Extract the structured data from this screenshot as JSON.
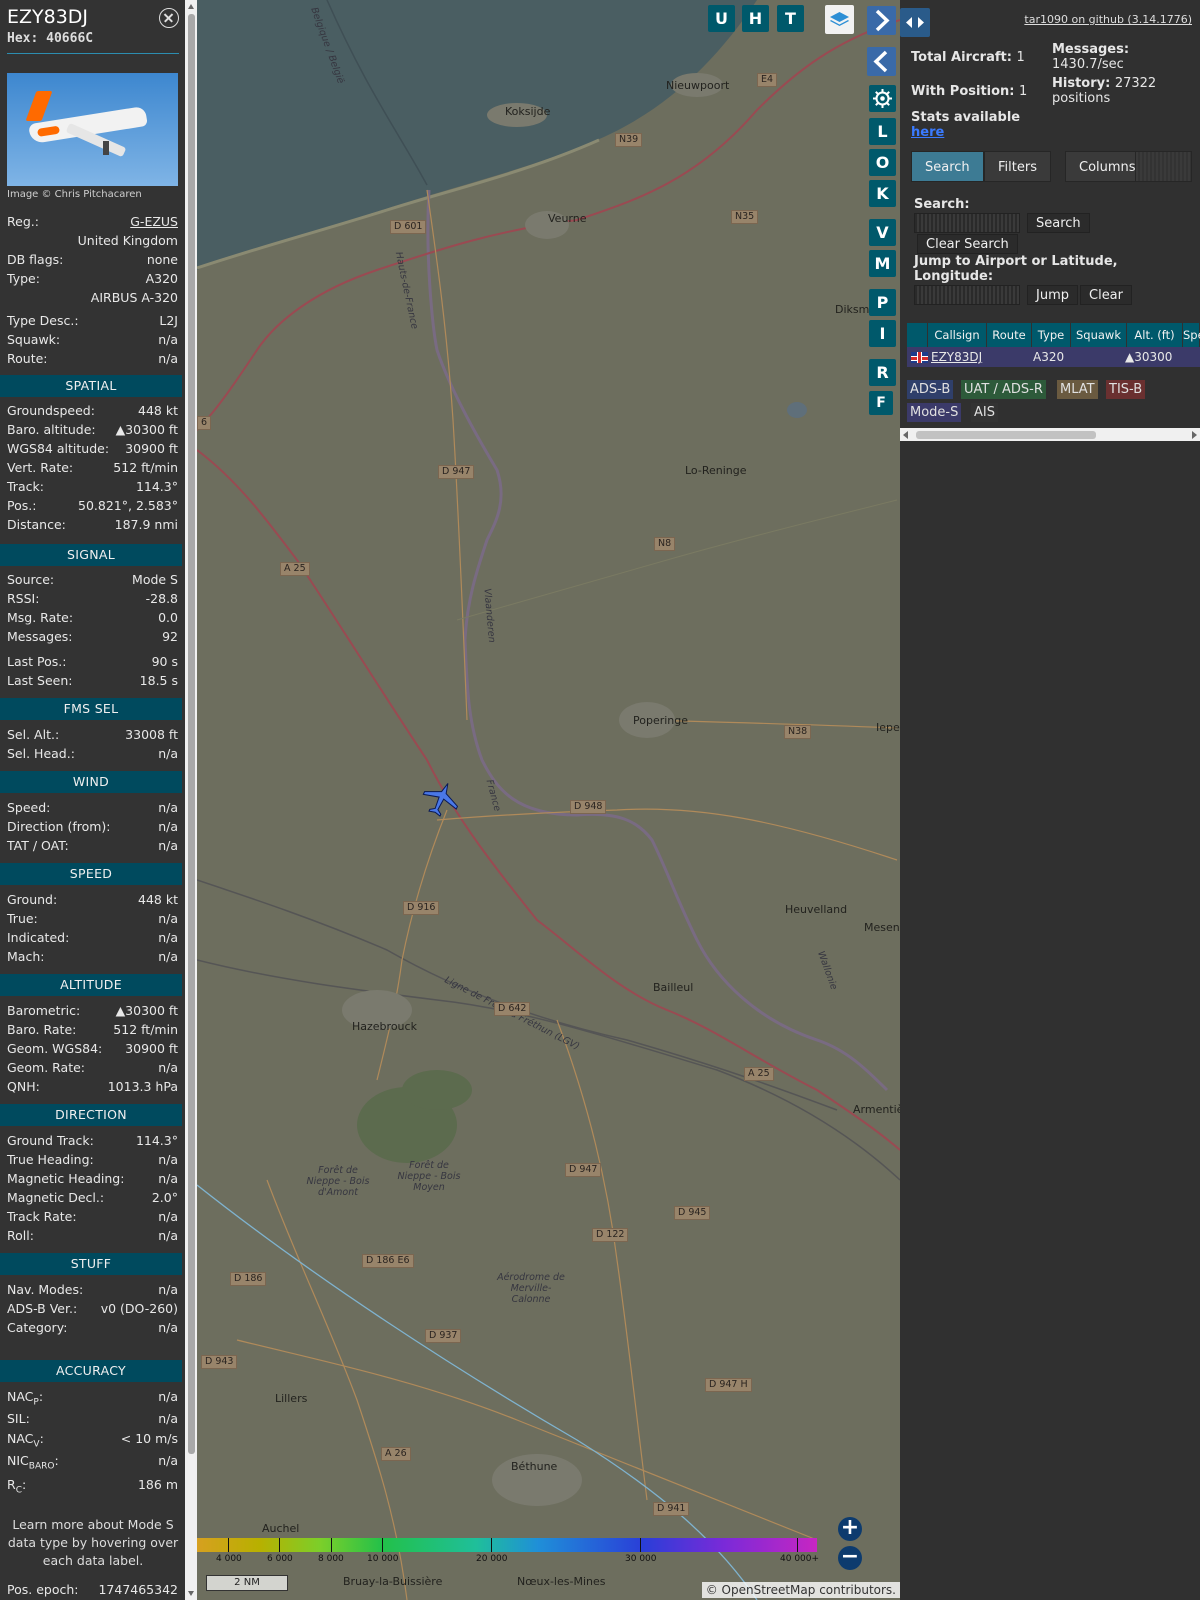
{
  "sidebar": {
    "callsign": "EZY83DJ",
    "hex_label": "Hex:",
    "hex": "40666C",
    "photo_credit": "Image © Chris Pitchacaren",
    "info_rows": [
      {
        "label": "Reg.:",
        "value": "G-EZUS"
      },
      {
        "label": "",
        "value": "United Kingdom"
      },
      {
        "label": "DB flags:",
        "value": "none"
      },
      {
        "label": "Type:",
        "value": "A320"
      },
      {
        "label": "",
        "value": "AIRBUS A-320"
      },
      {
        "label": "Type Desc.:",
        "value": "L2J"
      },
      {
        "label": "Squawk:",
        "value": "n/a"
      },
      {
        "label": "Route:",
        "value": "n/a"
      }
    ],
    "spatial": {
      "title": "SPATIAL",
      "rows": [
        {
          "label": "Groundspeed:",
          "value": "448 kt"
        },
        {
          "label": "Baro. altitude:",
          "value": "▲30300 ft"
        },
        {
          "label": "WGS84 altitude:",
          "value": "30900 ft"
        },
        {
          "label": "Vert. Rate:",
          "value": "512 ft/min"
        },
        {
          "label": "Track:",
          "value": "114.3°"
        },
        {
          "label": "Pos.:",
          "value": "50.821°, 2.583°"
        },
        {
          "label": "Distance:",
          "value": "187.9 nmi"
        }
      ]
    },
    "signal": {
      "title": "SIGNAL",
      "rows": [
        {
          "label": "Source:",
          "value": "Mode S"
        },
        {
          "label": "RSSI:",
          "value": "-28.8"
        },
        {
          "label": "Msg. Rate:",
          "value": "0.0"
        },
        {
          "label": "Messages:",
          "value": "92"
        },
        {
          "label": "Last Pos.:",
          "value": "90 s"
        },
        {
          "label": "Last Seen:",
          "value": "18.5 s"
        }
      ]
    },
    "fms": {
      "title": "FMS SEL",
      "rows": [
        {
          "label": "Sel. Alt.:",
          "value": "33008 ft"
        },
        {
          "label": "Sel. Head.:",
          "value": "n/a"
        }
      ]
    },
    "wind": {
      "title": "WIND",
      "rows": [
        {
          "label": "Speed:",
          "value": "n/a"
        },
        {
          "label": "Direction (from):",
          "value": "n/a"
        },
        {
          "label": "TAT / OAT:",
          "value": "n/a"
        }
      ]
    },
    "speed": {
      "title": "SPEED",
      "rows": [
        {
          "label": "Ground:",
          "value": "448 kt"
        },
        {
          "label": "True:",
          "value": "n/a"
        },
        {
          "label": "Indicated:",
          "value": "n/a"
        },
        {
          "label": "Mach:",
          "value": "n/a"
        }
      ]
    },
    "altitude": {
      "title": "ALTITUDE",
      "rows": [
        {
          "label": "Barometric:",
          "value": "▲30300 ft"
        },
        {
          "label": "Baro. Rate:",
          "value": "512 ft/min"
        },
        {
          "label": "Geom. WGS84:",
          "value": "30900 ft"
        },
        {
          "label": "Geom. Rate:",
          "value": "n/a"
        },
        {
          "label": "QNH:",
          "value": "1013.3 hPa"
        }
      ]
    },
    "direction": {
      "title": "DIRECTION",
      "rows": [
        {
          "label": "Ground Track:",
          "value": "114.3°"
        },
        {
          "label": "True Heading:",
          "value": "n/a"
        },
        {
          "label": "Magnetic Heading:",
          "value": "n/a"
        },
        {
          "label": "Magnetic Decl.:",
          "value": "2.0°"
        },
        {
          "label": "Track Rate:",
          "value": "n/a"
        },
        {
          "label": "Roll:",
          "value": "n/a"
        }
      ]
    },
    "stuff": {
      "title": "STUFF",
      "rows": [
        {
          "label": "Nav. Modes:",
          "value": "n/a"
        },
        {
          "label": "ADS-B Ver.:",
          "value": "v0 (DO-260)"
        },
        {
          "label": "Category:",
          "value": "n/a"
        }
      ]
    },
    "accuracy": {
      "title": "ACCURACY",
      "nacp": {
        "main": "NAC",
        "sub": "P",
        "value": "n/a"
      },
      "sil": {
        "label": "SIL:",
        "value": "n/a"
      },
      "nacv": {
        "main": "NAC",
        "sub": "V",
        "value": "< 10 m/s"
      },
      "nic": {
        "main": "NIC",
        "sub": "BARO",
        "value": "n/a"
      },
      "rc": {
        "main": "R",
        "sub": "C",
        "value": "186 m"
      }
    },
    "learn_more": "Learn more about Mode S data type by hovering over each data label.",
    "pos_epoch": {
      "label": "Pos. epoch:",
      "value": "1747465342"
    }
  },
  "map": {
    "top_buttons": [
      "U",
      "H",
      "T"
    ],
    "side_buttons": [
      "L",
      "O",
      "K",
      "V",
      "M",
      "P",
      "I",
      "R",
      "F"
    ],
    "places": [
      "Nieuwpoort",
      "Koksijde",
      "Veurne",
      "Diksm",
      "Lo-Reninge",
      "Poperinge",
      "Iepe",
      "Heuvelland",
      "Mesen",
      "Bailleul",
      "Hazebrouck",
      "Armentiè",
      "Lillers",
      "Béthune",
      "Auchel",
      "Bruay-la-Buissière",
      "Nœux-les-Mines"
    ],
    "small_places": [
      "Forêt de Nieppe - Bois d'Amont",
      "Forêt de Nieppe - Bois Moyen",
      "Aérodrome de Merville-Calonne",
      "Hauts-de-France",
      "Vlaanderen",
      "France",
      "Ligne de Fretin à Fréthun (LGV)",
      "Wallonie",
      "Belgique / België"
    ],
    "roads": [
      "D 601",
      "N39",
      "N35",
      "E4",
      "D 947",
      "N8",
      "A 25",
      "N38",
      "D 948",
      "D 916",
      "D 642",
      "A 25",
      "D 947",
      "D 945",
      "D 122",
      "D 186 E6",
      "D 186",
      "D 937",
      "D 943",
      "D 947 H",
      "A 26",
      "D 941",
      "6"
    ],
    "altitude_legend": [
      "4 000",
      "6 000",
      "8 000",
      "10 000",
      "20 000",
      "30 000",
      "40 000+"
    ],
    "scale": "2 NM",
    "attribution_prefix": "©",
    "attribution_link": "OpenStreetMap",
    "attribution_suffix": "contributors."
  },
  "panel": {
    "github": "tar1090 on github (3.14.1776)",
    "total_aircraft_label": "Total Aircraft:",
    "total_aircraft": "1",
    "with_position_label": "With Position:",
    "with_position": "1",
    "messages_label": "Messages:",
    "messages": "1430.7/sec",
    "history_label": "History:",
    "history": "27322",
    "history_unit": "positions",
    "stats_label": "Stats available",
    "stats_link": "here",
    "tabs": [
      "Search",
      "Filters",
      "Columns"
    ],
    "search_label": "Search:",
    "search_button": "Search",
    "clear_search_button": "Clear Search",
    "jump_label": "Jump to Airport or Latitude, Longitude:",
    "jump_button": "Jump",
    "clear_button": "Clear",
    "columns": [
      "Callsign",
      "Route",
      "Type",
      "Squawk",
      "Alt. (ft)",
      "Spe"
    ],
    "row": {
      "callsign": "EZY83DJ",
      "route": "",
      "type": "A320",
      "squawk": "",
      "alt": "▲30300"
    },
    "sources": [
      {
        "label": "ADS-B",
        "color": "#2f3f6a"
      },
      {
        "label": "UAT / ADS-R",
        "color": "#2d5a3a"
      },
      {
        "label": "MLAT",
        "color": "#6a5a40"
      },
      {
        "label": "TIS-B",
        "color": "#6a3030"
      },
      {
        "label": "Mode-S",
        "color": "#3b3a69"
      },
      {
        "label": "AIS",
        "color": "#333333"
      }
    ]
  }
}
